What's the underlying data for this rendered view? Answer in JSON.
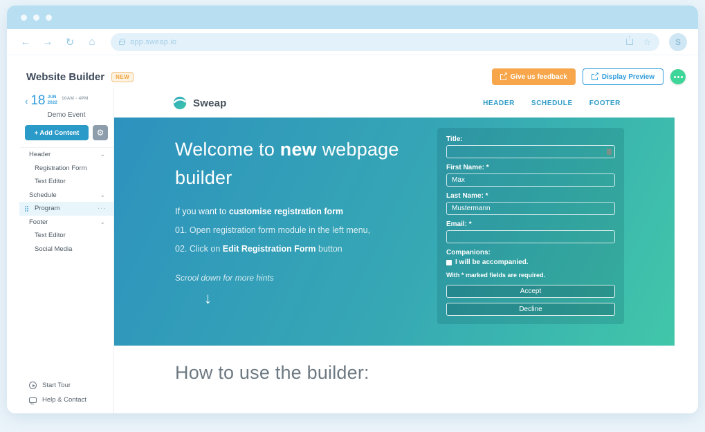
{
  "browser": {
    "url": "app.sweap.io",
    "avatar_letter": "S"
  },
  "topbar": {
    "title": "Website Builder",
    "badge": "NEW",
    "feedback_button": "Give us feedback",
    "preview_button": "Display Preview"
  },
  "sidebar": {
    "date_day": "18",
    "date_month": "JUN",
    "date_year": "2022",
    "date_time": "10AM - 4PM",
    "event_name": "Demo Event",
    "add_content_button": "+ Add Content",
    "menu": [
      {
        "label": "Header"
      },
      {
        "label": "Registration Form"
      },
      {
        "label": "Text Editor"
      },
      {
        "label": "Schedule"
      },
      {
        "label": "Program"
      },
      {
        "label": "Footer"
      },
      {
        "label": "Text Editor"
      },
      {
        "label": "Social Media"
      }
    ],
    "footer": [
      {
        "label": "Start Tour"
      },
      {
        "label": "Help & Contact"
      }
    ]
  },
  "preview": {
    "logo_text": "Sweap",
    "nav": [
      "HEADER",
      "SCHEDULE",
      "FOOTER"
    ],
    "hero": {
      "title_pre": "Welcome to ",
      "title_bold": "new",
      "title_post": " webpage builder",
      "intro_pre": "If you want to ",
      "intro_bold": "customise registration form",
      "step1": "01. Open registration form module in the left menu,",
      "step2_pre": "02. Click on ",
      "step2_bold": "Edit Registration Form",
      "step2_post": " button",
      "scroll_hint": "Scrool down for more hints",
      "arrow": "↓"
    },
    "form": {
      "title_label": "Title:",
      "title_value": "",
      "first_name_label": "First Name: *",
      "first_name_value": "Max",
      "last_name_label": "Last Name: *",
      "last_name_value": "Mustermann",
      "email_label": "Email: *",
      "email_value": "",
      "companions_label": "Companions:",
      "companions_checkbox_label": "I will be accompanied.",
      "required_note": "With * marked fields are required.",
      "accept_button": "Accept",
      "decline_button": "Decline"
    },
    "section_heading": "How to use the builder:"
  },
  "colors": {
    "accent_blue": "#2D9CDB",
    "accent_orange": "#F7A64B",
    "brand_green": "#3ED598",
    "hero_gradient_start": "#2E92BE",
    "hero_gradient_end": "#41C6A9",
    "browser_chrome": "#B7DEF1"
  }
}
